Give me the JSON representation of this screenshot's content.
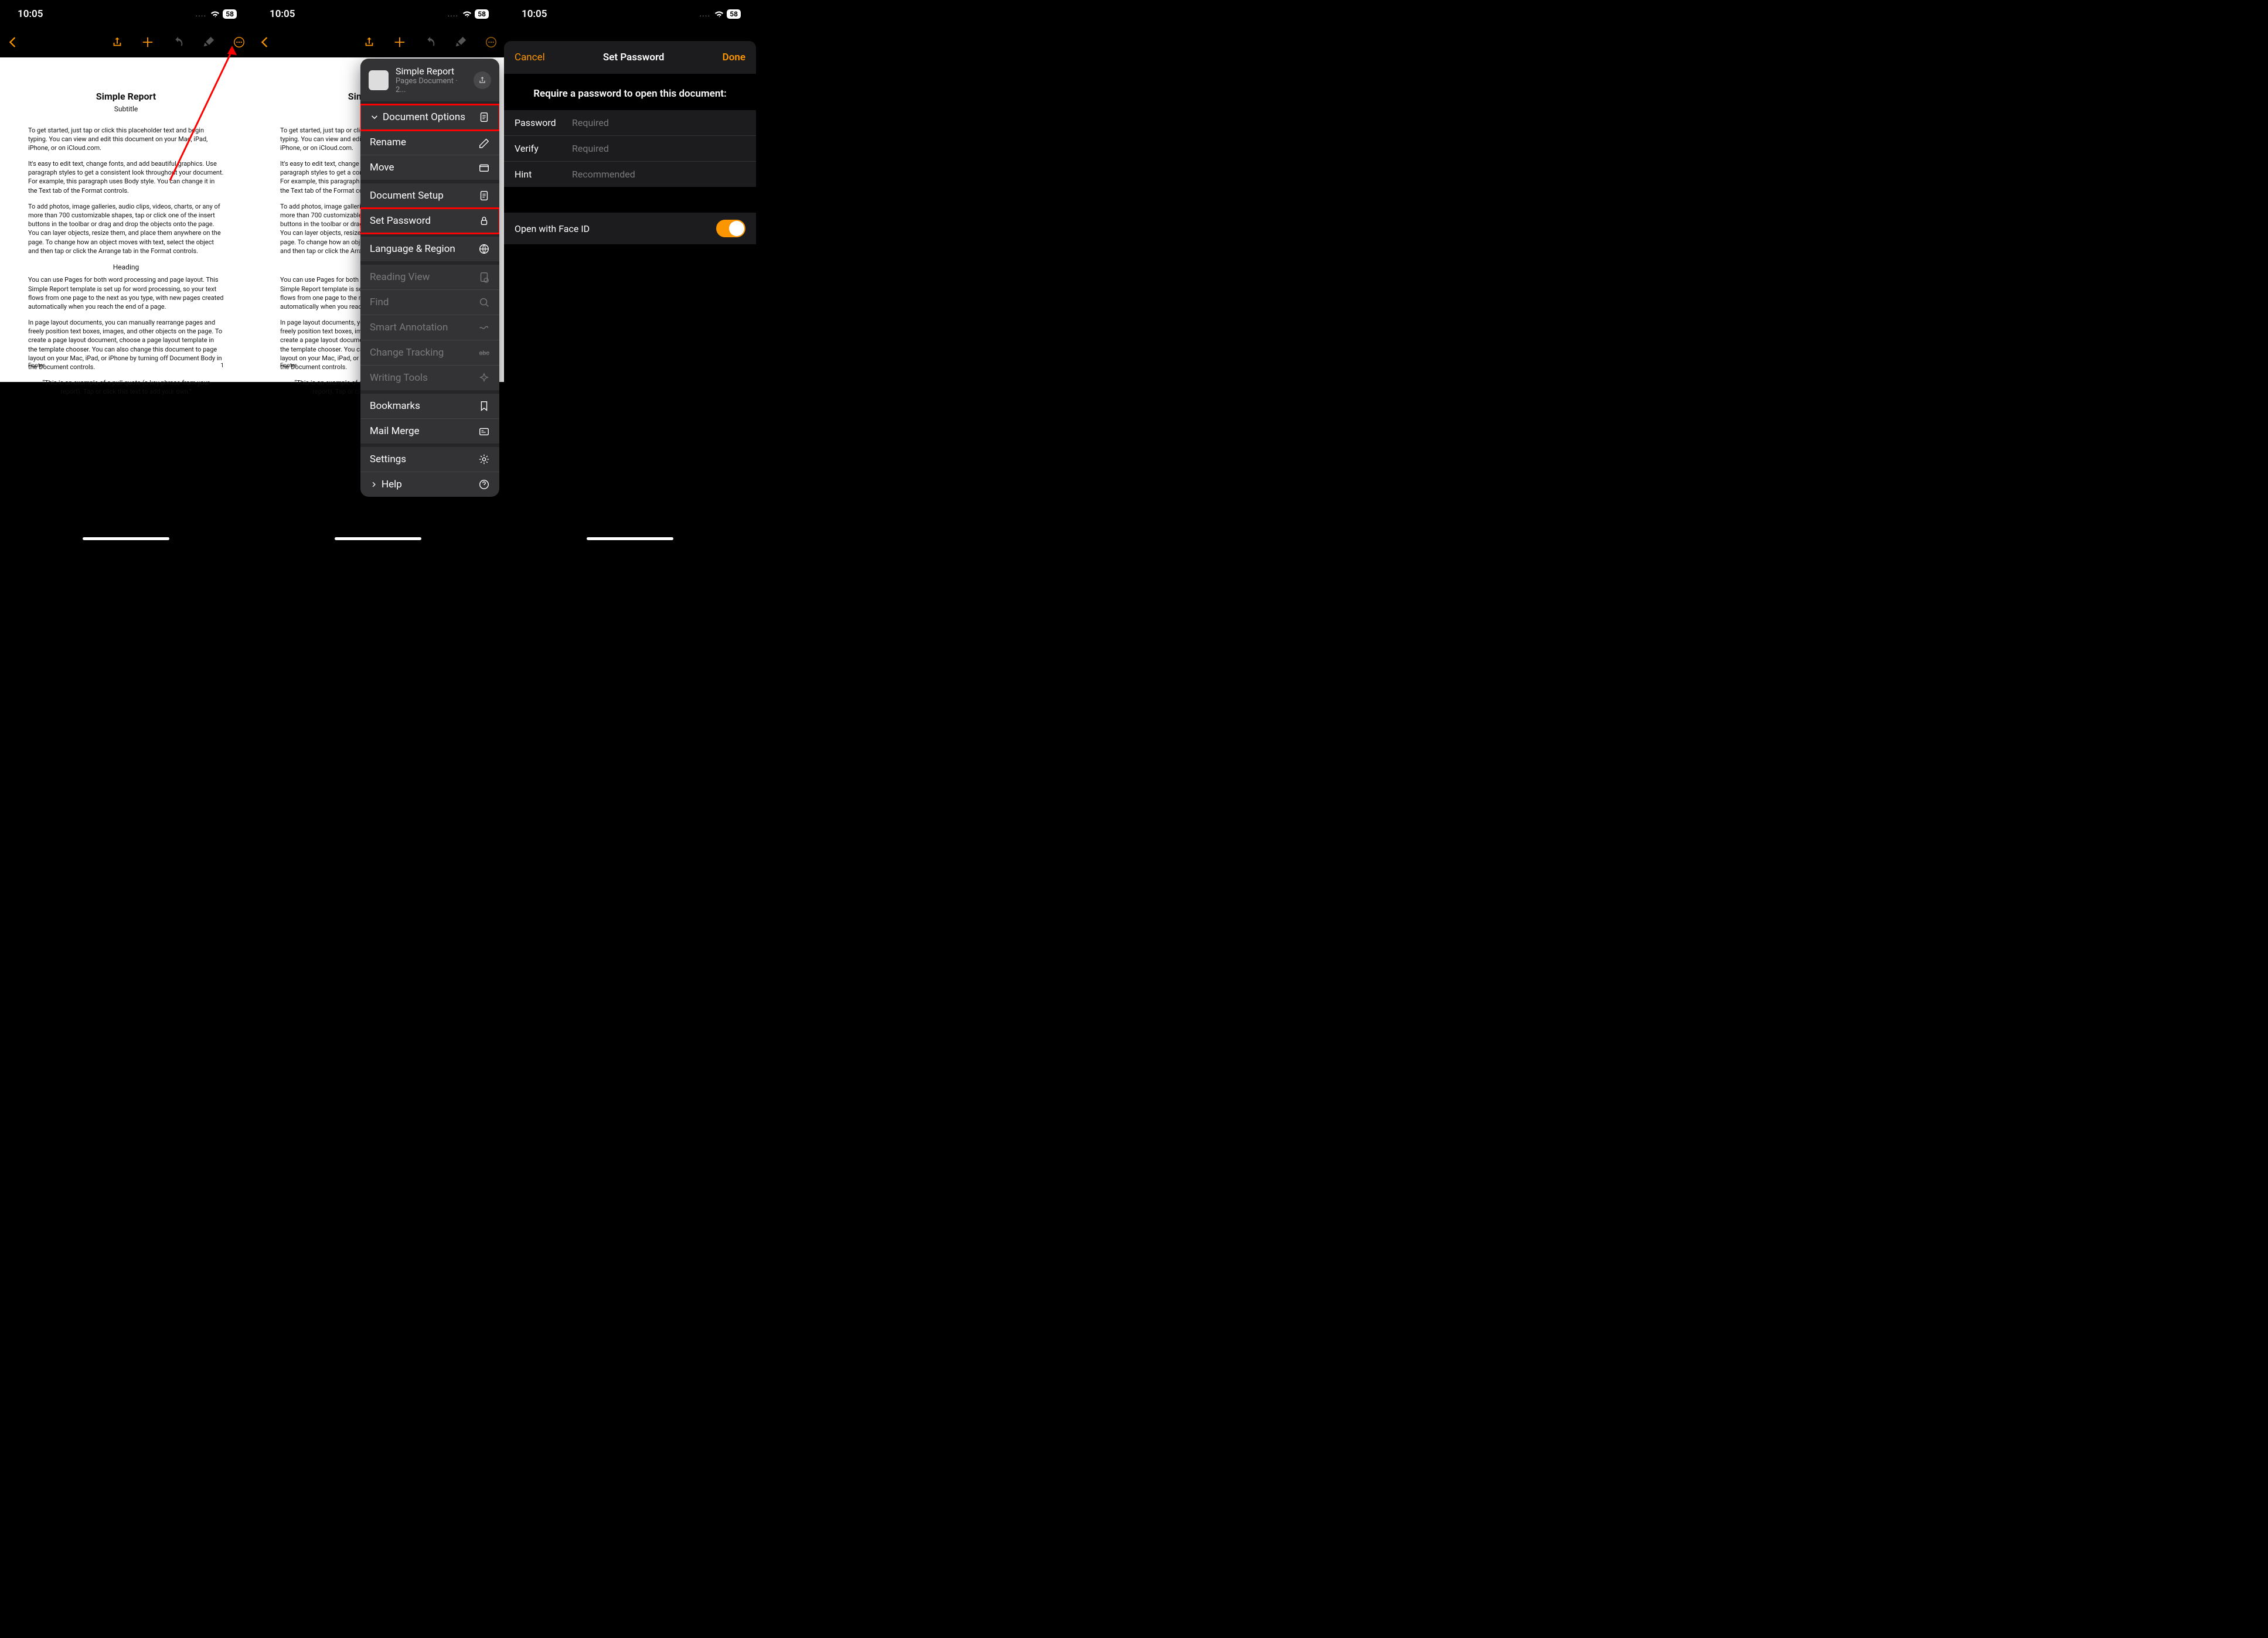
{
  "status": {
    "time": "10:05",
    "battery": "58"
  },
  "document": {
    "title": "Simple Report",
    "subtitle": "Subtitle",
    "p1": "To get started, just tap or click this placeholder text and begin typing. You can view and edit this document on your Mac, iPad, iPhone, or on iCloud.com.",
    "p2": "It's easy to edit text, change fonts, and add beautiful graphics. Use paragraph styles to get a consistent look throughout your document. For example, this paragraph uses Body style. You can change it in the Text tab of the Format controls.",
    "p3": "To add photos, image galleries, audio clips, videos, charts, or any of more than 700 customizable shapes, tap or click one of the insert buttons in the toolbar or drag and drop the objects onto the page. You can layer objects, resize them, and place them anywhere on the page. To change how an object moves with text, select the object and then tap or click the Arrange tab in the Format controls.",
    "heading": "Heading",
    "p4": "You can use Pages for both word processing and page layout. This Simple Report template is set up for word processing, so your text flows from one page to the next as you type, with new pages created automatically when you reach the end of a page.",
    "p5": "In page layout documents, you can manually rearrange pages and freely position text boxes, images, and other objects on the page. To create a page layout document, choose a page layout template in the template chooser. You can also change this document to page layout on your Mac, iPad, or iPhone by turning off Document Body in the Document controls.",
    "quote": "“This is an example of a pull quote (a key phrase from your report). Tap or click this text to add your own.”",
    "footer_left": "Footer",
    "footer_right": "1"
  },
  "menu": {
    "header_title": "Simple Report",
    "header_sub": "Pages Document · 2...",
    "items": {
      "doc_options": "Document Options",
      "rename": "Rename",
      "move": "Move",
      "doc_setup": "Document Setup",
      "set_password": "Set Password",
      "lang_region": "Language & Region",
      "reading_view": "Reading View",
      "find": "Find",
      "smart_annotation": "Smart Annotation",
      "change_tracking": "Change Tracking",
      "writing_tools": "Writing Tools",
      "bookmarks": "Bookmarks",
      "mail_merge": "Mail Merge",
      "settings": "Settings",
      "help": "Help"
    }
  },
  "modal": {
    "cancel": "Cancel",
    "title": "Set Password",
    "done": "Done",
    "instruction": "Require a password to open this document:",
    "password_label": "Password",
    "password_placeholder": "Required",
    "verify_label": "Verify",
    "verify_placeholder": "Required",
    "hint_label": "Hint",
    "hint_placeholder": "Recommended",
    "faceid_label": "Open with Face ID"
  }
}
